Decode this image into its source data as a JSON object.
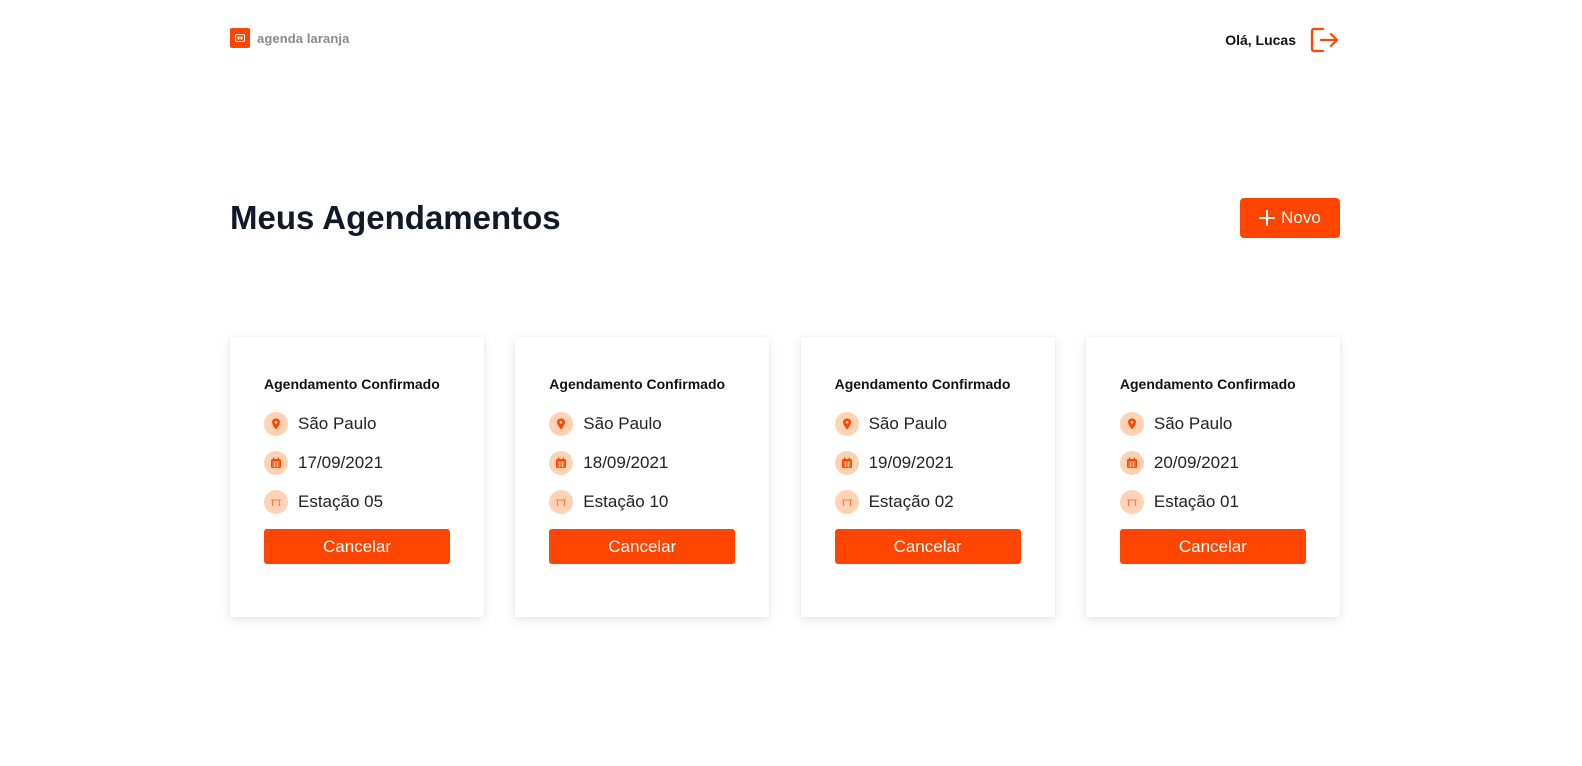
{
  "brand": {
    "name": "agenda laranja"
  },
  "header": {
    "greeting": "Olá, Lucas",
    "logout_icon": "logout-icon"
  },
  "main": {
    "title": "Meus Agendamentos",
    "new_button_label": "Novo"
  },
  "colors": {
    "accent": "#ff4500",
    "icon_bg": "#ffd2b3",
    "title": "#111827",
    "brand_text": "#8a8a8a"
  },
  "cards": [
    {
      "title": "Agendamento Confirmado",
      "location": "São Paulo",
      "date": "17/09/2021",
      "station": "Estação 05",
      "cancel_label": "Cancelar"
    },
    {
      "title": "Agendamento Confirmado",
      "location": "São Paulo",
      "date": "18/09/2021",
      "station": "Estação 10",
      "cancel_label": "Cancelar"
    },
    {
      "title": "Agendamento Confirmado",
      "location": "São Paulo",
      "date": "19/09/2021",
      "station": "Estação 02",
      "cancel_label": "Cancelar"
    },
    {
      "title": "Agendamento Confirmado",
      "location": "São Paulo",
      "date": "20/09/2021",
      "station": "Estação 01",
      "cancel_label": "Cancelar"
    }
  ],
  "icons": {
    "location": "map-pin-icon",
    "date": "calendar-icon",
    "station": "desk-icon"
  }
}
